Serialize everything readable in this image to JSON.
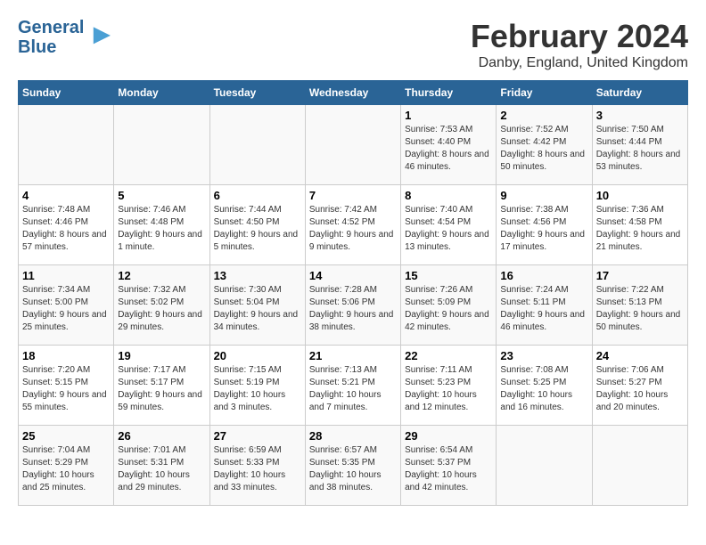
{
  "header": {
    "logo_line1": "General",
    "logo_line2": "Blue",
    "month_year": "February 2024",
    "location": "Danby, England, United Kingdom"
  },
  "calendar": {
    "weekdays": [
      "Sunday",
      "Monday",
      "Tuesday",
      "Wednesday",
      "Thursday",
      "Friday",
      "Saturday"
    ],
    "weeks": [
      [
        {
          "day": "",
          "sunrise": "",
          "sunset": "",
          "daylight": ""
        },
        {
          "day": "",
          "sunrise": "",
          "sunset": "",
          "daylight": ""
        },
        {
          "day": "",
          "sunrise": "",
          "sunset": "",
          "daylight": ""
        },
        {
          "day": "",
          "sunrise": "",
          "sunset": "",
          "daylight": ""
        },
        {
          "day": "1",
          "sunrise": "Sunrise: 7:53 AM",
          "sunset": "Sunset: 4:40 PM",
          "daylight": "Daylight: 8 hours and 46 minutes."
        },
        {
          "day": "2",
          "sunrise": "Sunrise: 7:52 AM",
          "sunset": "Sunset: 4:42 PM",
          "daylight": "Daylight: 8 hours and 50 minutes."
        },
        {
          "day": "3",
          "sunrise": "Sunrise: 7:50 AM",
          "sunset": "Sunset: 4:44 PM",
          "daylight": "Daylight: 8 hours and 53 minutes."
        }
      ],
      [
        {
          "day": "4",
          "sunrise": "Sunrise: 7:48 AM",
          "sunset": "Sunset: 4:46 PM",
          "daylight": "Daylight: 8 hours and 57 minutes."
        },
        {
          "day": "5",
          "sunrise": "Sunrise: 7:46 AM",
          "sunset": "Sunset: 4:48 PM",
          "daylight": "Daylight: 9 hours and 1 minute."
        },
        {
          "day": "6",
          "sunrise": "Sunrise: 7:44 AM",
          "sunset": "Sunset: 4:50 PM",
          "daylight": "Daylight: 9 hours and 5 minutes."
        },
        {
          "day": "7",
          "sunrise": "Sunrise: 7:42 AM",
          "sunset": "Sunset: 4:52 PM",
          "daylight": "Daylight: 9 hours and 9 minutes."
        },
        {
          "day": "8",
          "sunrise": "Sunrise: 7:40 AM",
          "sunset": "Sunset: 4:54 PM",
          "daylight": "Daylight: 9 hours and 13 minutes."
        },
        {
          "day": "9",
          "sunrise": "Sunrise: 7:38 AM",
          "sunset": "Sunset: 4:56 PM",
          "daylight": "Daylight: 9 hours and 17 minutes."
        },
        {
          "day": "10",
          "sunrise": "Sunrise: 7:36 AM",
          "sunset": "Sunset: 4:58 PM",
          "daylight": "Daylight: 9 hours and 21 minutes."
        }
      ],
      [
        {
          "day": "11",
          "sunrise": "Sunrise: 7:34 AM",
          "sunset": "Sunset: 5:00 PM",
          "daylight": "Daylight: 9 hours and 25 minutes."
        },
        {
          "day": "12",
          "sunrise": "Sunrise: 7:32 AM",
          "sunset": "Sunset: 5:02 PM",
          "daylight": "Daylight: 9 hours and 29 minutes."
        },
        {
          "day": "13",
          "sunrise": "Sunrise: 7:30 AM",
          "sunset": "Sunset: 5:04 PM",
          "daylight": "Daylight: 9 hours and 34 minutes."
        },
        {
          "day": "14",
          "sunrise": "Sunrise: 7:28 AM",
          "sunset": "Sunset: 5:06 PM",
          "daylight": "Daylight: 9 hours and 38 minutes."
        },
        {
          "day": "15",
          "sunrise": "Sunrise: 7:26 AM",
          "sunset": "Sunset: 5:09 PM",
          "daylight": "Daylight: 9 hours and 42 minutes."
        },
        {
          "day": "16",
          "sunrise": "Sunrise: 7:24 AM",
          "sunset": "Sunset: 5:11 PM",
          "daylight": "Daylight: 9 hours and 46 minutes."
        },
        {
          "day": "17",
          "sunrise": "Sunrise: 7:22 AM",
          "sunset": "Sunset: 5:13 PM",
          "daylight": "Daylight: 9 hours and 50 minutes."
        }
      ],
      [
        {
          "day": "18",
          "sunrise": "Sunrise: 7:20 AM",
          "sunset": "Sunset: 5:15 PM",
          "daylight": "Daylight: 9 hours and 55 minutes."
        },
        {
          "day": "19",
          "sunrise": "Sunrise: 7:17 AM",
          "sunset": "Sunset: 5:17 PM",
          "daylight": "Daylight: 9 hours and 59 minutes."
        },
        {
          "day": "20",
          "sunrise": "Sunrise: 7:15 AM",
          "sunset": "Sunset: 5:19 PM",
          "daylight": "Daylight: 10 hours and 3 minutes."
        },
        {
          "day": "21",
          "sunrise": "Sunrise: 7:13 AM",
          "sunset": "Sunset: 5:21 PM",
          "daylight": "Daylight: 10 hours and 7 minutes."
        },
        {
          "day": "22",
          "sunrise": "Sunrise: 7:11 AM",
          "sunset": "Sunset: 5:23 PM",
          "daylight": "Daylight: 10 hours and 12 minutes."
        },
        {
          "day": "23",
          "sunrise": "Sunrise: 7:08 AM",
          "sunset": "Sunset: 5:25 PM",
          "daylight": "Daylight: 10 hours and 16 minutes."
        },
        {
          "day": "24",
          "sunrise": "Sunrise: 7:06 AM",
          "sunset": "Sunset: 5:27 PM",
          "daylight": "Daylight: 10 hours and 20 minutes."
        }
      ],
      [
        {
          "day": "25",
          "sunrise": "Sunrise: 7:04 AM",
          "sunset": "Sunset: 5:29 PM",
          "daylight": "Daylight: 10 hours and 25 minutes."
        },
        {
          "day": "26",
          "sunrise": "Sunrise: 7:01 AM",
          "sunset": "Sunset: 5:31 PM",
          "daylight": "Daylight: 10 hours and 29 minutes."
        },
        {
          "day": "27",
          "sunrise": "Sunrise: 6:59 AM",
          "sunset": "Sunset: 5:33 PM",
          "daylight": "Daylight: 10 hours and 33 minutes."
        },
        {
          "day": "28",
          "sunrise": "Sunrise: 6:57 AM",
          "sunset": "Sunset: 5:35 PM",
          "daylight": "Daylight: 10 hours and 38 minutes."
        },
        {
          "day": "29",
          "sunrise": "Sunrise: 6:54 AM",
          "sunset": "Sunset: 5:37 PM",
          "daylight": "Daylight: 10 hours and 42 minutes."
        },
        {
          "day": "",
          "sunrise": "",
          "sunset": "",
          "daylight": ""
        },
        {
          "day": "",
          "sunrise": "",
          "sunset": "",
          "daylight": ""
        }
      ]
    ]
  }
}
